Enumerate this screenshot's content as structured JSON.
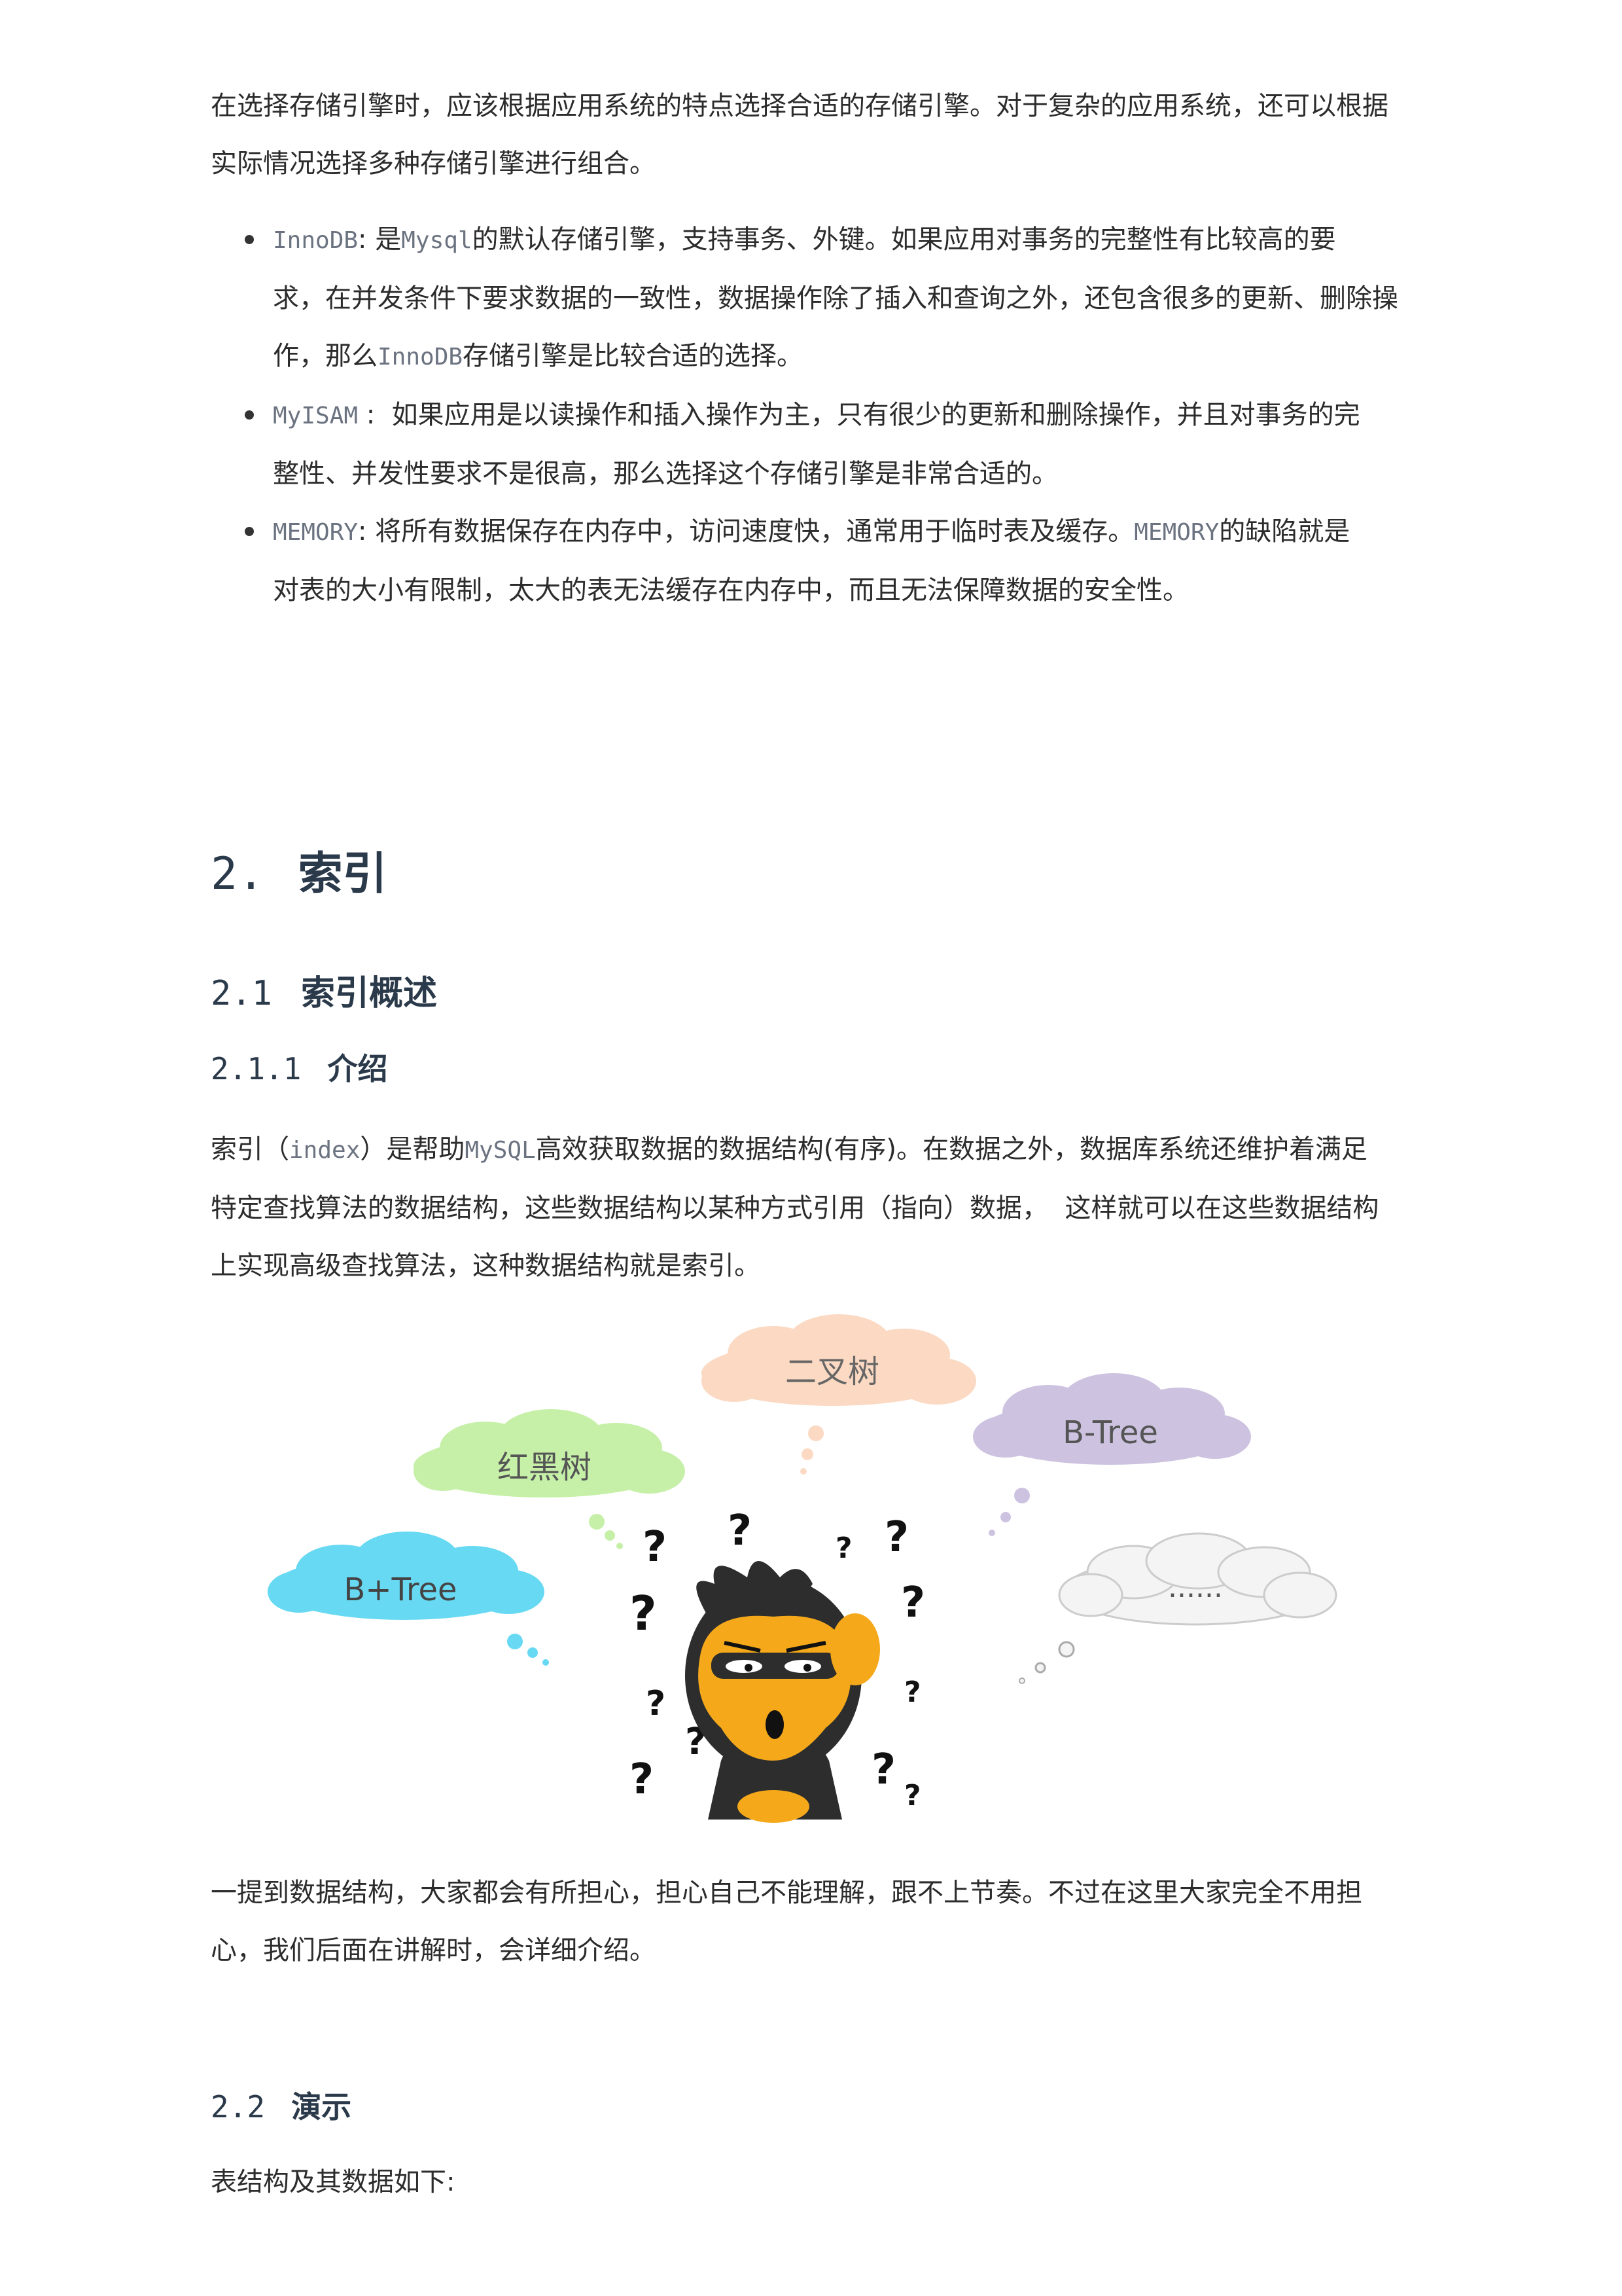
{
  "intro": {
    "line1": "在选择存储引擎时，应该根据应用系统的特点选择合适的存储引擎。对于复杂的应用系统，还可以根据",
    "line2": "实际情况选择多种存储引擎进行组合。"
  },
  "engines": [
    {
      "name": "InnoDB",
      "sep": ": ",
      "l1_a": "是",
      "l1_code": "Mysql",
      "l1_b": "的默认存储引擎，支持事务、外键。如果应用对事务的完整性有比较高的要",
      "l2": "求，在并发条件下要求数据的一致性，数据操作除了插入和查询之外，还包含很多的更新、删除操",
      "l3_a": "作，那么",
      "l3_code": "InnoDB",
      "l3_b": "存储引擎是比较合适的选择。"
    },
    {
      "name": "MyISAM",
      "sep": " :  ",
      "l1": "如果应用是以读操作和插入操作为主，只有很少的更新和删除操作，并且对事务的完",
      "l2": "整性、并发性要求不是很高，那么选择这个存储引擎是非常合适的。"
    },
    {
      "name": "MEMORY",
      "sep": ": ",
      "l1_a": "将所有数据保存在内存中，访问速度快，通常用于临时表及缓存。",
      "l1_code": "MEMORY",
      "l1_b": "的缺陷就是",
      "l2": "对表的大小有限制，太大的表无法缓存在内存中，而且无法保障数据的安全性。"
    }
  ],
  "section2": {
    "num": "2.",
    "title": "索引"
  },
  "section21": {
    "num": "2.1",
    "title": "索引概述"
  },
  "section211": {
    "num": "2.1.1",
    "title": "介绍"
  },
  "index_para": {
    "l1_a": "索引（",
    "l1_code": "index",
    "l1_b": "）是帮助",
    "l1_code2": "MySQL",
    "l1_c": "高效获取数据的数据结构(有序)。在数据之外，数据库系统还维护着满足",
    "l2": "特定查找算法的数据结构，这些数据结构以某种方式引用（指向）数据，  这样就可以在这些数据结构",
    "l3": "上实现高级查找算法，这种数据结构就是索引。"
  },
  "figure": {
    "clouds": {
      "binary_tree": "二叉树",
      "red_black": "红黑树",
      "btree": "B-Tree",
      "bplus": "B+Tree",
      "more": "......"
    },
    "colors": {
      "binary_tree": "#fbd9c2",
      "red_black": "#c6f0a8",
      "btree": "#cdc3e0",
      "bplus": "#67d9f2",
      "more": "#f4f4f4",
      "monkey_body": "#2d2d2d",
      "monkey_face": "#f5a91a"
    }
  },
  "after_figure": {
    "l1": "一提到数据结构，大家都会有所担心，担心自己不能理解，跟不上节奏。不过在这里大家完全不用担",
    "l2": "心，我们后面在讲解时，会详细介绍。"
  },
  "section22": {
    "num": "2.2",
    "title": "演示"
  },
  "table_intro": "表结构及其数据如下:"
}
